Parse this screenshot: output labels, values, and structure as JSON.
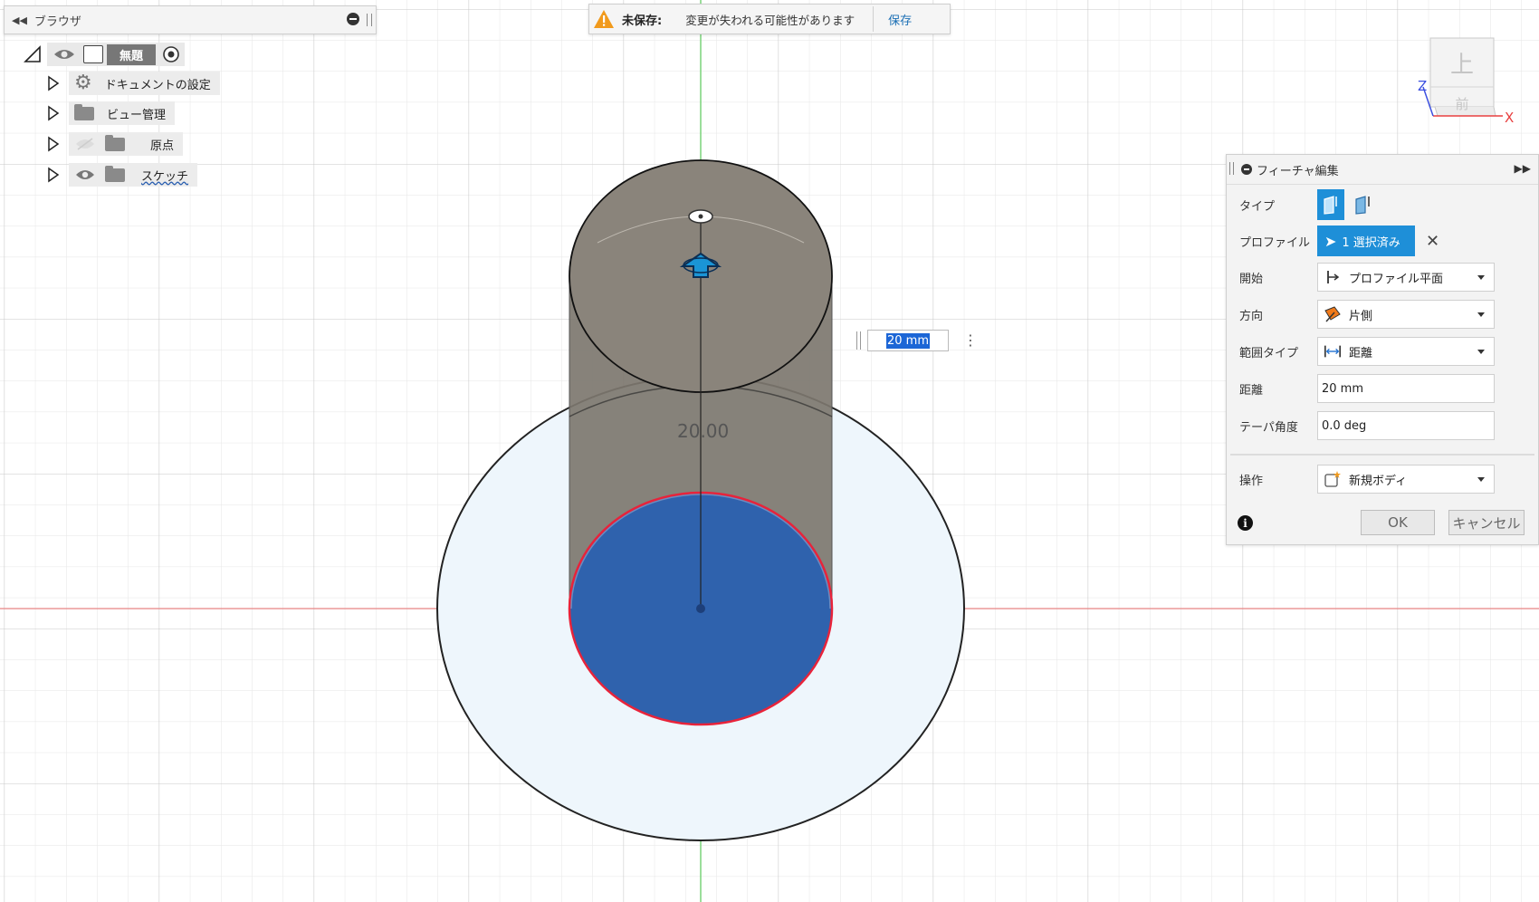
{
  "browser": {
    "title": "ブラウザ",
    "collapse_icon": "double-left-arrow",
    "root": {
      "label": "無題"
    },
    "items": [
      {
        "label": "ドキュメントの設定",
        "icon": "gear-icon"
      },
      {
        "label": "ビュー管理",
        "icon": "folder-icon"
      },
      {
        "label": "原点",
        "icon": "folder-icon"
      },
      {
        "label": "スケッチ",
        "icon": "folder-icon"
      }
    ]
  },
  "warning": {
    "label": "未保存:",
    "message": "変更が失われる可能性があります",
    "save": "保存"
  },
  "viewcube": {
    "face_top": "上",
    "face_front": "前",
    "axis_x": "X",
    "axis_z": "Z"
  },
  "feature": {
    "title": "フィーチャ編集",
    "rows": {
      "type": "タイプ",
      "profile": "プロファイル",
      "start": "開始",
      "direction": "方向",
      "extent": "範囲タイプ",
      "distance": "距離",
      "taper": "テーパ角度",
      "operation": "操作"
    },
    "profile_selected": "1 選択済み",
    "start_value": "プロファイル平面",
    "direction_value": "片側",
    "extent_value": "距離",
    "distance_value": "20 mm",
    "taper_value": "0.0 deg",
    "operation_value": "新規ボディ",
    "ok": "OK",
    "cancel": "キャンセル"
  },
  "dimension": {
    "input_value": "20 mm",
    "label": "20.00"
  },
  "colors": {
    "grid": "#dcdcdc",
    "axis_green": "#6fd06f",
    "axis_red": "#e36a6a",
    "profile_blue": "#2f62ad",
    "body_gray": "#7d776f",
    "accent": "#1e8fd8"
  }
}
